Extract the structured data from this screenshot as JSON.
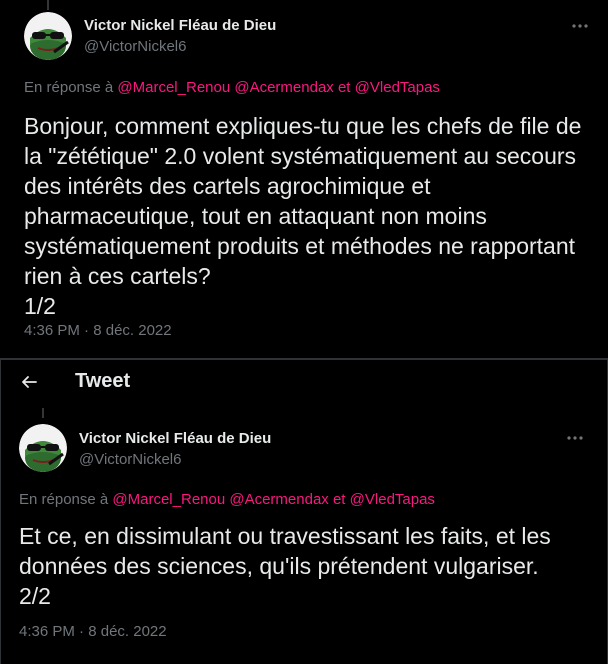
{
  "tweets": [
    {
      "author_name": "Victor Nickel Fléau de Dieu",
      "author_handle": "@VictorNickel6",
      "reply_prefix": "En réponse à",
      "mentions": [
        "@Marcel_Renou",
        "@Acermendax",
        "et",
        "@VledTapas"
      ],
      "text": "Bonjour, comment expliques-tu que les chefs de file de la \"zététique\" 2.0  volent systématiquement au secours des intérêts des cartels agrochimique et pharmaceutique, tout en attaquant non moins systématiquement produits et méthodes ne rapportant rien à ces cartels?\n1/2",
      "time": "4:36 PM",
      "date": "8 déc. 2022"
    },
    {
      "author_name": "Victor Nickel Fléau de Dieu",
      "author_handle": "@VictorNickel6",
      "reply_prefix": "En réponse à",
      "mentions": [
        "@Marcel_Renou",
        "@Acermendax",
        "et",
        "@VledTapas"
      ],
      "text": "Et ce, en dissimulant ou travestissant les faits, et les données des sciences, qu'ils prétendent vulgariser.\n2/2",
      "time": "4:36 PM",
      "date": "8 déc. 2022"
    }
  ],
  "header": {
    "title": "Tweet",
    "back_icon": "arrow-left-icon"
  },
  "separator": "·",
  "colors": {
    "background": "#000000",
    "text": "#e7e9ea",
    "muted": "#71767b",
    "mention": "#f91880"
  }
}
